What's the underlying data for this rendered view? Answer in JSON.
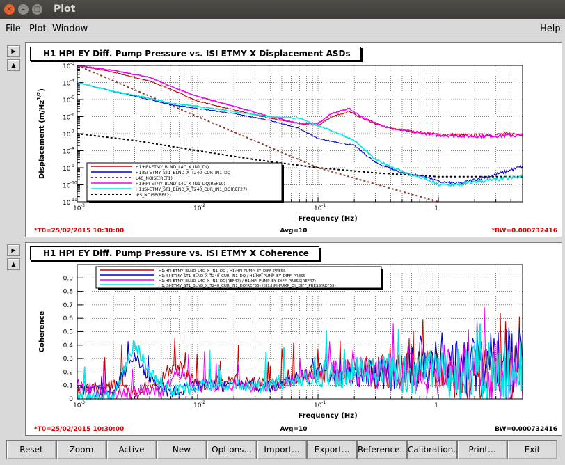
{
  "window": {
    "title": "Plot"
  },
  "menus": {
    "file": "File",
    "plot": "Plot",
    "window": "Window",
    "help": "Help"
  },
  "top_plot": {
    "title": "H1 HPI EY Diff. Pump Pressure vs. ISI ETMY X Displacement ASDs",
    "t0": "*T0=25/02/2015 10:30:00",
    "avg": "Avg=10",
    "bw": "*BW=0.000732416",
    "xlabel": "Frequency (Hz)",
    "ylabel": "Displacement (m/Hz",
    "ylabel_exp": "1/2",
    "ylabel_close": ")",
    "xticks": [
      "10",
      "10",
      "10",
      "1"
    ],
    "xtick_exps": [
      "-3",
      "-2",
      "-1",
      ""
    ],
    "yticks": [
      "10",
      "10",
      "10",
      "10",
      "10",
      "10",
      "10",
      "10",
      "10"
    ],
    "ytick_exps": [
      "-3",
      "-4",
      "-5",
      "-6",
      "-7",
      "-8",
      "-9",
      "-10",
      "-11"
    ],
    "legend": [
      {
        "label": "H1:HPI-ETMY_BLND_L4C_X_IN1_DQ",
        "color": "#cc0000",
        "style": "solid"
      },
      {
        "label": "H1:ISI-ETMY_ST1_BLND_X_T240_CUR_IN1_DQ",
        "color": "#0000cc",
        "style": "solid"
      },
      {
        "label": "L4C_NOISE(REF1)",
        "color": "#8b3a2a",
        "style": "dashed"
      },
      {
        "label": "H1:HPI-ETMY_BLND_L4C_X_IN1_DQ(REF19)",
        "color": "#ee00ee",
        "style": "solid"
      },
      {
        "label": "H1:ISI-ETMY_ST1_BLND_X_T240_CUR_IN1_DQ(REF27)",
        "color": "#00e5e5",
        "style": "solid"
      },
      {
        "label": "IPS_NOISE(REF2)",
        "color": "#000000",
        "style": "dashed"
      }
    ]
  },
  "bottom_plot": {
    "title": "H1 HPI EY Diff. Pump Pressure vs. ISI ETMY X Coherence",
    "t0": "*T0=25/02/2015 10:30:00",
    "avg": "Avg=10",
    "bw": "BW=0.000732416",
    "xlabel": "Frequency (Hz)",
    "ylabel": "Coherence",
    "xticks": [
      "10",
      "10",
      "10",
      "1"
    ],
    "xtick_exps": [
      "-3",
      "-2",
      "-1",
      ""
    ],
    "yticks": [
      "0.9",
      "0.8",
      "0.7",
      "0.6",
      "0.5",
      "0.4",
      "0.3",
      "0.2",
      "0.1",
      "0"
    ],
    "legend": [
      {
        "label": "H1:HPI-ETMY_BLND_L4C_X_IN1_DQ / H1:HPI-PUMP_EY_DIFF_PRESS",
        "color": "#cc0000"
      },
      {
        "label": "H1:ISI-ETMY_ST1_BLND_X_T240_CUR_IN1_DQ / H1:HPI-PUMP_EY_DIFF_PRESS",
        "color": "#0000cc"
      },
      {
        "label": "H1:HPI-ETMY_BLND_L4C_X_IN1_DQ(REF47) / H1:HPI-PUMP_EY_DIFF_PRESS(REF47)",
        "color": "#ee00ee"
      },
      {
        "label": "H1:ISI-ETMY_ST1_BLND_X_T240_CUR_IN1_DQ(REF55) / H1:HPI-PUMP_EY_DIFF_PRESS(REF55)",
        "color": "#00e5e5"
      }
    ]
  },
  "chart_data": [
    {
      "type": "line",
      "title": "H1 HPI EY Diff. Pump Pressure vs. ISI ETMY X Displacement ASDs",
      "xlabel": "Frequency (Hz)",
      "ylabel": "Displacement (m/Hz^1/2)",
      "xscale": "log",
      "yscale": "log",
      "xlim": [
        0.001,
        5
      ],
      "ylim": [
        1e-11,
        0.001
      ],
      "grid": true,
      "legend_position": "bottom-left",
      "series": [
        {
          "name": "H1:HPI-ETMY_BLND_L4C_X_IN1_DQ",
          "color": "#cc0000",
          "x": [
            0.001,
            0.002,
            0.004,
            0.006,
            0.01,
            0.02,
            0.04,
            0.07,
            0.1,
            0.13,
            0.18,
            0.25,
            0.4,
            0.7,
            1,
            2,
            5
          ],
          "y": [
            0.001,
            0.0004,
            0.00012,
            4e-05,
            8e-06,
            2.5e-06,
            8e-07,
            4e-07,
            3e-07,
            1e-06,
            2e-06,
            6e-07,
            2e-07,
            1.2e-07,
            9e-08,
            8e-08,
            1e-07
          ]
        },
        {
          "name": "H1:ISI-ETMY_ST1_BLND_X_T240_CUR_IN1_DQ",
          "color": "#0000cc",
          "x": [
            0.001,
            0.002,
            0.004,
            0.006,
            0.01,
            0.02,
            0.04,
            0.07,
            0.1,
            0.15,
            0.2,
            0.3,
            0.5,
            0.8,
            1,
            1.5,
            2,
            3,
            5
          ],
          "y": [
            0.0001,
            3e-05,
            1e-05,
            5e-06,
            3e-06,
            1.5e-06,
            6e-07,
            2e-07,
            5e-08,
            3e-08,
            2e-08,
            2e-09,
            5e-10,
            3e-10,
            1.5e-10,
            1.2e-10,
            2e-10,
            4e-10,
            1.2e-09
          ]
        },
        {
          "name": "L4C_NOISE(REF1)",
          "color": "#8b3a2a",
          "x": [
            0.001,
            0.01,
            0.1,
            1
          ],
          "y": [
            0.001,
            1e-06,
            1e-09,
            1e-11
          ]
        },
        {
          "name": "H1:HPI-ETMY_BLND_L4C_X_IN1_DQ(REF19)",
          "color": "#ee00ee",
          "x": [
            0.001,
            0.002,
            0.004,
            0.006,
            0.01,
            0.02,
            0.04,
            0.07,
            0.1,
            0.13,
            0.18,
            0.25,
            0.4,
            0.7,
            1,
            2,
            5
          ],
          "y": [
            0.001,
            0.0005,
            0.0002,
            6e-05,
            1.5e-05,
            4e-06,
            1e-06,
            4e-07,
            4e-07,
            1.5e-06,
            3e-06,
            7e-07,
            2e-07,
            1.1e-07,
            8e-08,
            7e-08,
            8e-08
          ]
        },
        {
          "name": "H1:ISI-ETMY_ST1_BLND_X_T240_CUR_IN1_DQ(REF27)",
          "color": "#00e5e5",
          "x": [
            0.001,
            0.002,
            0.004,
            0.006,
            0.01,
            0.02,
            0.04,
            0.07,
            0.1,
            0.15,
            0.2,
            0.3,
            0.5,
            0.8,
            1,
            1.5,
            2,
            3,
            5
          ],
          "y": [
            0.0001,
            3e-05,
            1.2e-05,
            6e-06,
            4e-06,
            2e-06,
            1e-06,
            8e-07,
            3e-07,
            1e-07,
            4e-08,
            3e-09,
            6e-10,
            2e-10,
            1e-10,
            1e-10,
            1.5e-10,
            2e-10,
            3e-10
          ]
        },
        {
          "name": "IPS_NOISE(REF2)",
          "color": "#000000",
          "x": [
            0.001,
            0.003,
            0.01,
            0.03,
            0.1,
            0.3,
            1,
            5
          ],
          "y": [
            1e-07,
            4e-08,
            1e-08,
            3e-09,
            1e-09,
            5e-10,
            3e-10,
            3e-10
          ]
        }
      ]
    },
    {
      "type": "line",
      "title": "H1 HPI EY Diff. Pump Pressure vs. ISI ETMY X Coherence",
      "xlabel": "Frequency (Hz)",
      "ylabel": "Coherence",
      "xscale": "log",
      "xlim": [
        0.001,
        5
      ],
      "ylim": [
        0,
        1
      ],
      "grid": true,
      "legend_position": "top",
      "series": [
        {
          "name": "H1:HPI-ETMY_BLND_L4C_X_IN1_DQ / H1:HPI-PUMP_EY_DIFF_PRESS",
          "color": "#cc0000",
          "x": [
            0.001,
            0.002,
            0.003,
            0.005,
            0.007,
            0.01,
            0.02,
            0.04,
            0.07,
            0.1,
            0.2,
            0.4,
            0.7,
            1,
            2,
            5
          ],
          "y": [
            0.05,
            0.1,
            0.03,
            0.15,
            0.25,
            0.1,
            0.15,
            0.1,
            0.15,
            0.2,
            0.2,
            0.2,
            0.25,
            0.2,
            0.2,
            0.2
          ]
        },
        {
          "name": "H1:ISI-ETMY_ST1_BLND_X_T240_CUR_IN1_DQ / H1:HPI-PUMP_EY_DIFF_PRESS",
          "color": "#0000cc",
          "x": [
            0.001,
            0.002,
            0.003,
            0.004,
            0.006,
            0.01,
            0.02,
            0.04,
            0.07,
            0.1,
            0.2,
            0.4,
            0.7,
            1,
            2,
            5
          ],
          "y": [
            0.08,
            0.05,
            0.33,
            0.15,
            0.05,
            0.1,
            0.1,
            0.1,
            0.15,
            0.2,
            0.2,
            0.2,
            0.25,
            0.25,
            0.25,
            0.3
          ]
        },
        {
          "name": "H1:HPI-ETMY_BLND_L4C_X_IN1_DQ(REF47) / H1:HPI-PUMP_EY_DIFF_PRESS(REF47)",
          "color": "#ee00ee",
          "x": [
            0.001,
            0.002,
            0.003,
            0.005,
            0.007,
            0.01,
            0.02,
            0.04,
            0.07,
            0.1,
            0.2,
            0.4,
            0.7,
            1,
            2,
            5
          ],
          "y": [
            0.1,
            0.02,
            0.05,
            0.05,
            0.2,
            0.1,
            0.1,
            0.1,
            0.15,
            0.2,
            0.2,
            0.2,
            0.2,
            0.2,
            0.2,
            0.2
          ]
        },
        {
          "name": "H1:ISI-ETMY_ST1_BLND_X_T240_CUR_IN1_DQ(REF55) / H1:HPI-PUMP_EY_DIFF_PRESS(REF55)",
          "color": "#00e5e5",
          "x": [
            0.001,
            0.002,
            0.003,
            0.004,
            0.006,
            0.01,
            0.02,
            0.04,
            0.07,
            0.1,
            0.2,
            0.4,
            0.7,
            1,
            2,
            5
          ],
          "y": [
            0.02,
            0.02,
            0.42,
            0.2,
            0.05,
            0.1,
            0.1,
            0.1,
            0.15,
            0.15,
            0.2,
            0.2,
            0.2,
            0.2,
            0.2,
            0.2
          ]
        }
      ]
    }
  ],
  "toolbar": [
    "Reset",
    "Zoom",
    "Active",
    "New",
    "Options...",
    "Import...",
    "Export...",
    "Reference...",
    "Calibration...",
    "Print...",
    "Exit"
  ]
}
